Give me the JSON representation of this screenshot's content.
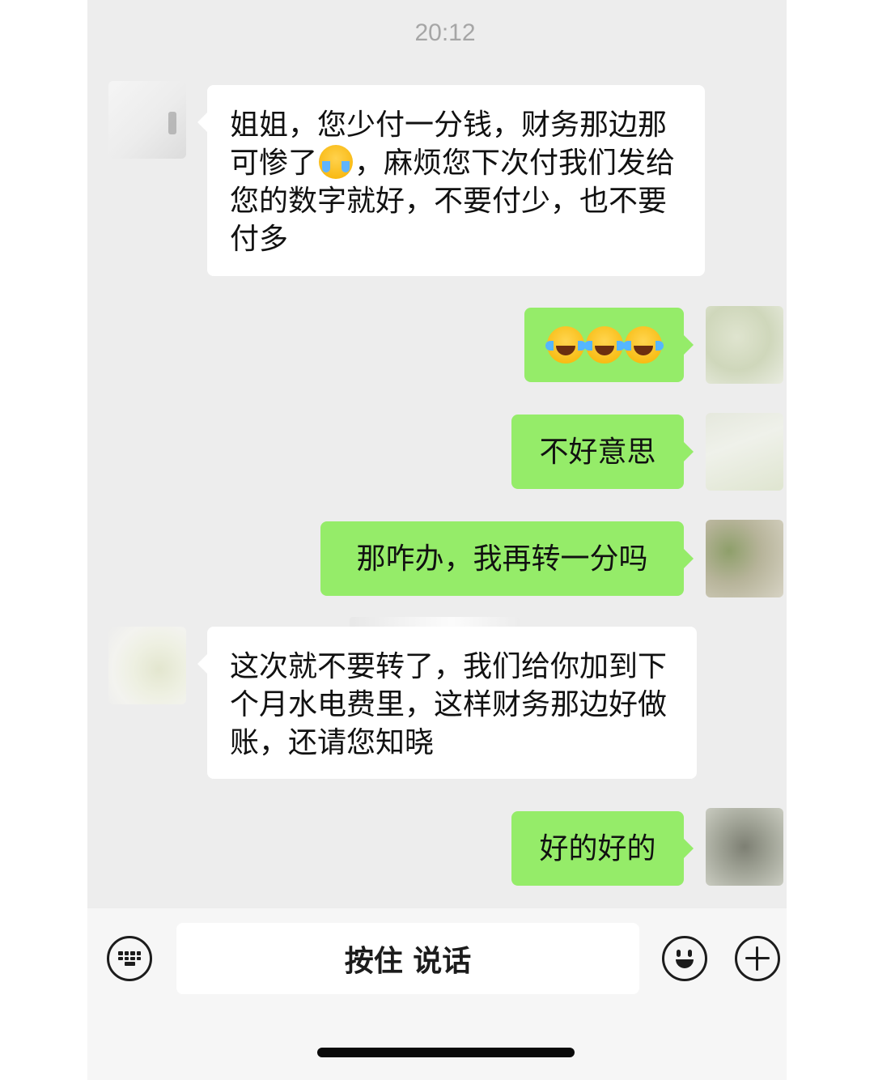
{
  "chat": {
    "timestamp": "20:12",
    "messages": [
      {
        "side": "left",
        "text": "姐姐，您少付一分钱，财务那边那可惨了",
        "emoji": "crying-laughing-face-emoji",
        "text_after": "，麻烦您下次付我们发给您的数字就好，不要付少，也不要付多"
      },
      {
        "side": "right",
        "emoji": "tears-of-joy-emoji",
        "count": 3
      },
      {
        "side": "right",
        "text": "不好意思"
      },
      {
        "side": "right",
        "text": "那咋办，我再转一分吗"
      },
      {
        "side": "left",
        "text": "这次就不要转了，我们给你加到下个月水电费里，这样财务那边好做账，还请您知晓"
      },
      {
        "side": "right",
        "text": "好的好的"
      }
    ]
  },
  "input_bar": {
    "voice_label": "按住 说话",
    "left_icon": "keyboard-icon",
    "emoji_icon": "emoji-icon",
    "plus_icon": "plus-icon"
  },
  "colors": {
    "background": "#ededed",
    "sent_bubble": "#95ec69",
    "received_bubble": "#ffffff"
  }
}
